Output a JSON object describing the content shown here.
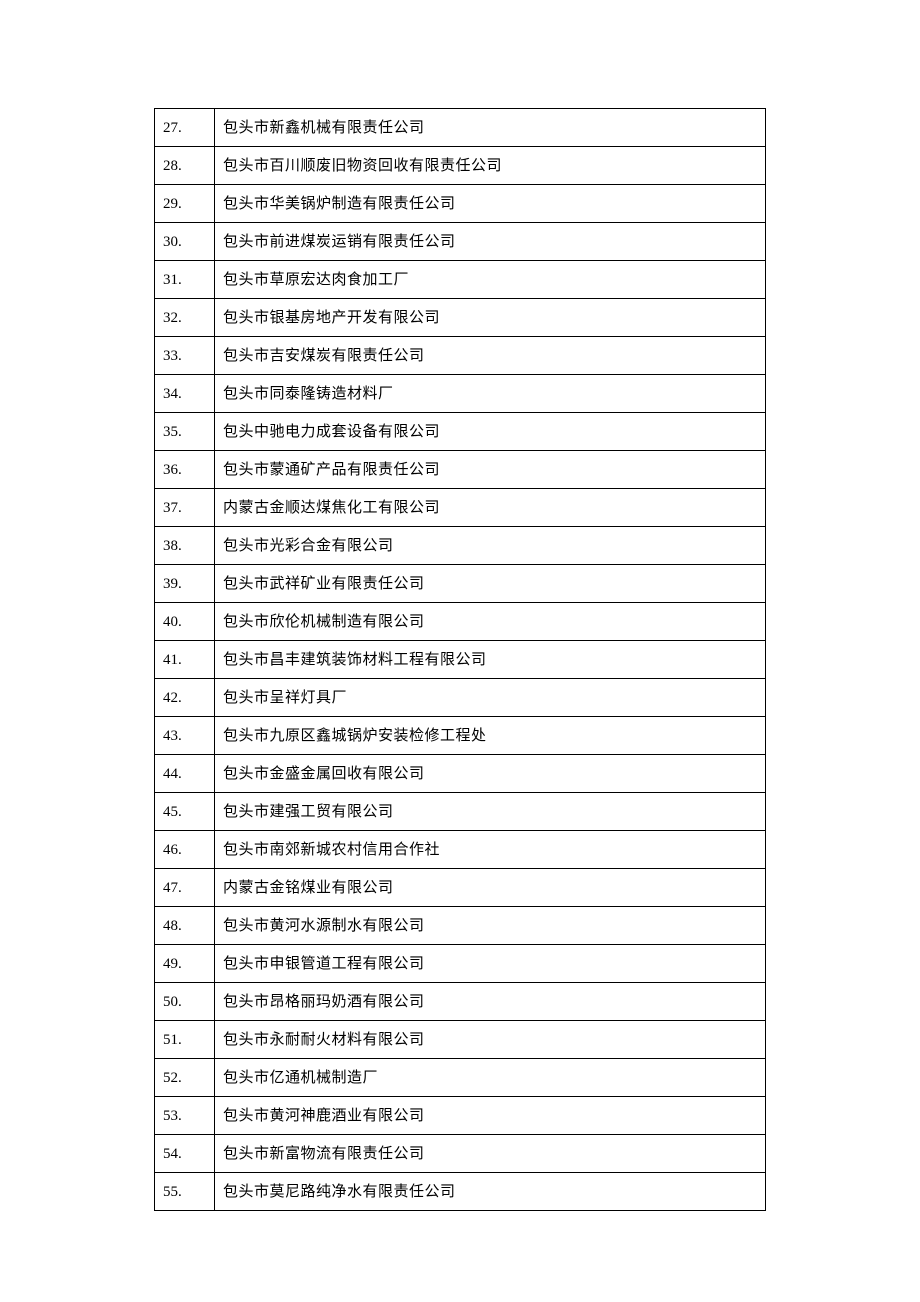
{
  "rows": [
    {
      "num": "27.",
      "name": "包头市新鑫机械有限责任公司"
    },
    {
      "num": "28.",
      "name": "包头市百川顺废旧物资回收有限责任公司"
    },
    {
      "num": "29.",
      "name": "包头市华美锅炉制造有限责任公司"
    },
    {
      "num": "30.",
      "name": "包头市前进煤炭运销有限责任公司"
    },
    {
      "num": "31.",
      "name": "包头市草原宏达肉食加工厂"
    },
    {
      "num": "32.",
      "name": "包头市银基房地产开发有限公司"
    },
    {
      "num": "33.",
      "name": "包头市吉安煤炭有限责任公司"
    },
    {
      "num": "34.",
      "name": "包头市同泰隆铸造材料厂"
    },
    {
      "num": "35.",
      "name": "包头中驰电力成套设备有限公司"
    },
    {
      "num": "36.",
      "name": "包头市蒙通矿产品有限责任公司"
    },
    {
      "num": "37.",
      "name": "内蒙古金顺达煤焦化工有限公司"
    },
    {
      "num": "38.",
      "name": "包头市光彩合金有限公司"
    },
    {
      "num": "39.",
      "name": "包头市武祥矿业有限责任公司"
    },
    {
      "num": "40.",
      "name": "包头市欣伦机械制造有限公司"
    },
    {
      "num": "41.",
      "name": "包头市昌丰建筑装饰材料工程有限公司"
    },
    {
      "num": "42.",
      "name": "包头市呈祥灯具厂"
    },
    {
      "num": "43.",
      "name": "包头市九原区鑫城锅炉安装检修工程处"
    },
    {
      "num": "44.",
      "name": "包头市金盛金属回收有限公司"
    },
    {
      "num": "45.",
      "name": "包头市建强工贸有限公司"
    },
    {
      "num": "46.",
      "name": "包头市南郊新城农村信用合作社"
    },
    {
      "num": "47.",
      "name": "内蒙古金铭煤业有限公司"
    },
    {
      "num": "48.",
      "name": "包头市黄河水源制水有限公司"
    },
    {
      "num": "49.",
      "name": "包头市申银管道工程有限公司"
    },
    {
      "num": "50.",
      "name": "包头市昂格丽玛奶酒有限公司"
    },
    {
      "num": "51.",
      "name": "包头市永耐耐火材料有限公司"
    },
    {
      "num": "52.",
      "name": "包头市亿通机械制造厂"
    },
    {
      "num": "53.",
      "name": "包头市黄河神鹿酒业有限公司"
    },
    {
      "num": "54.",
      "name": "包头市新富物流有限责任公司"
    },
    {
      "num": "55.",
      "name": "包头市莫尼路纯净水有限责任公司"
    }
  ]
}
